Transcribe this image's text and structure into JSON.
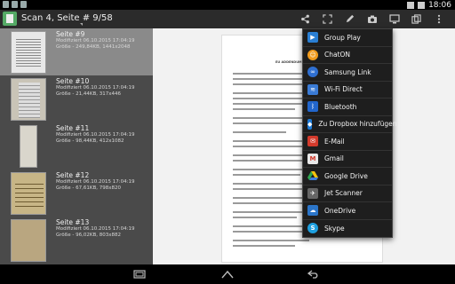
{
  "statusbar": {
    "time": "18:06"
  },
  "actionbar": {
    "title": "Scan 4, Seite # 9/58",
    "icons": [
      "share-icon",
      "fullscreen-icon",
      "edit-icon",
      "camera-icon",
      "screen-icon",
      "copy-icon",
      "overflow-menu-icon"
    ]
  },
  "list": {
    "items": [
      {
        "title": "Seite #9",
        "meta1": "Modifiziert 06.10.2015 17:04:19",
        "meta2": "Größe - 249,84KB, 1441x2048"
      },
      {
        "title": "Seite #10",
        "meta1": "Modifiziert 06.10.2015 17:04:19",
        "meta2": "Größe - 21,44KB, 317x446"
      },
      {
        "title": "Seite #11",
        "meta1": "Modifiziert 06.10.2015 17:04:19",
        "meta2": "Größe - 98,44KB, 412x1082"
      },
      {
        "title": "Seite #12",
        "meta1": "Modifiziert 06.10.2015 17:04:19",
        "meta2": "Größe - 67,61KB, 798x820"
      },
      {
        "title": "Seite #13",
        "meta1": "Modifiziert 06.10.2015 17:04:19",
        "meta2": "Größe - 96,02KB, 803x882"
      }
    ]
  },
  "document": {
    "heading": "EU ADDENDUM"
  },
  "share_menu": {
    "items": [
      {
        "label": "Group Play",
        "icon": "group-play-icon",
        "color": "#2a7fd4"
      },
      {
        "label": "ChatON",
        "icon": "chaton-icon",
        "color": "#f29b1d"
      },
      {
        "label": "Samsung Link",
        "icon": "samsung-link-icon",
        "color": "#2f6fd0"
      },
      {
        "label": "Wi-Fi Direct",
        "icon": "wifi-direct-icon",
        "color": "#3a7bd5"
      },
      {
        "label": "Bluetooth",
        "icon": "bluetooth-icon",
        "color": "#2266cc"
      },
      {
        "label": "Zu Dropbox hinzufügen",
        "icon": "dropbox-icon",
        "color": "#1e7ad6"
      },
      {
        "label": "E-Mail",
        "icon": "email-icon",
        "color": "#d33a2c"
      },
      {
        "label": "Gmail",
        "icon": "gmail-icon",
        "color": "#e8e8e8"
      },
      {
        "label": "Google Drive",
        "icon": "google-drive-icon",
        "color": "#2fa84f"
      },
      {
        "label": "Jet Scanner",
        "icon": "jet-scanner-icon",
        "color": "#666666"
      },
      {
        "label": "OneDrive",
        "icon": "onedrive-icon",
        "color": "#2b75c9"
      },
      {
        "label": "Skype",
        "icon": "skype-icon",
        "color": "#1ea0e0"
      }
    ]
  }
}
